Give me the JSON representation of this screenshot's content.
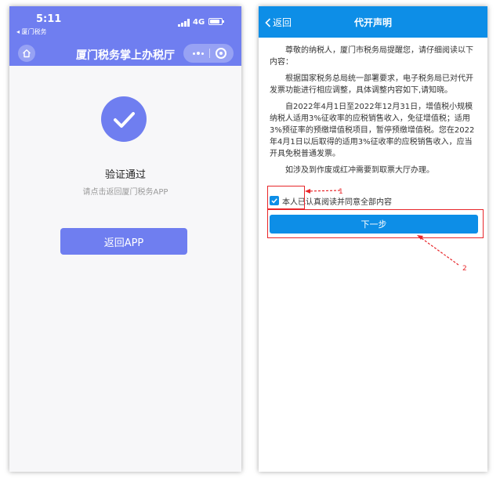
{
  "left": {
    "status": {
      "time": "5:11",
      "back_label": "◂ 厦门税务",
      "network": "4G"
    },
    "header": {
      "title": "厦门税务掌上办税厅"
    },
    "result": {
      "title": "验证通过",
      "subtitle": "请点击返回厦门税务APP"
    },
    "return_button": "返回APP",
    "colors": {
      "accent": "#6f7ef0"
    },
    "icons": [
      "home-icon",
      "more-dots-icon",
      "close-capsule-icon",
      "check-icon"
    ]
  },
  "right": {
    "header": {
      "back": "返回",
      "title": "代开声明"
    },
    "notice": {
      "paragraphs": [
        "尊敬的纳税人，厦门市税务局提醒您，请仔细阅读以下内容：",
        "根据国家税务总局统一部署要求，电子税务局已对代开发票功能进行相应调整，具体调整内容如下,请知晓。",
        "自2022年4月1日至2022年12月31日，增值税小规模纳税人适用3%征收率的应税销售收入，免征增值税；适用3%预征率的预缴增值税项目，暂停预缴增值税。您在2022年4月1日以后取得的适用3%征收率的应税销售收入，应当开具免税普通发票。",
        "如涉及到作废或红冲需要到取票大厅办理。"
      ]
    },
    "agree_label": "本人已认真阅读并同意全部内容",
    "next_button": "下一步",
    "annotations": [
      "1",
      "2"
    ],
    "colors": {
      "accent": "#0d8ee7",
      "annotation": "#e8262a"
    },
    "icons": [
      "chevron-left-icon",
      "checkbox-check-icon"
    ]
  }
}
